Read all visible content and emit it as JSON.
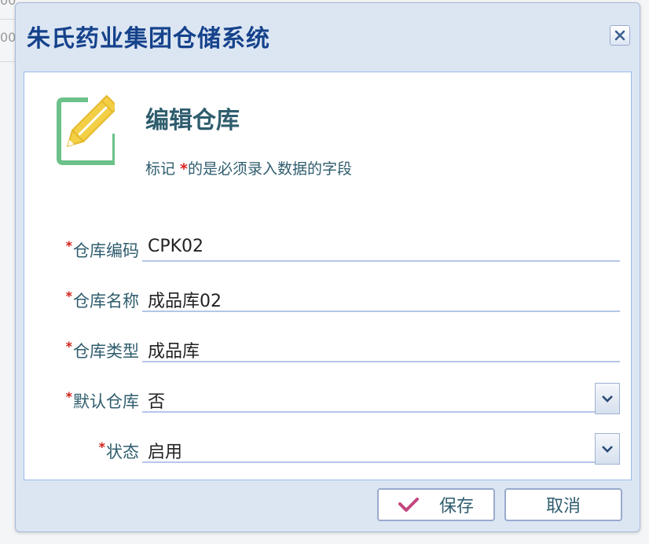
{
  "background": {
    "fragments": [
      "00",
      "00"
    ]
  },
  "dialog": {
    "title": "朱氏药业集团仓储系统",
    "close_icon": "close-icon",
    "edit_icon": "edit-pencil-icon",
    "heading": "编辑仓库",
    "hint_prefix": "标记 ",
    "hint_star": "*",
    "hint_suffix": "的是必须录入数据的字段"
  },
  "form": {
    "required_mark": "*",
    "fields": [
      {
        "label": "仓库编码",
        "value": "CPK02"
      },
      {
        "label": "仓库名称",
        "value": "成品库02"
      },
      {
        "label": "仓库类型",
        "value": "成品库"
      },
      {
        "label": "默认仓库",
        "value": "否"
      },
      {
        "label": "状态",
        "value": "启用"
      }
    ]
  },
  "footer": {
    "save_label": "保存",
    "cancel_label": "取消"
  },
  "colors": {
    "title": "#15428b",
    "text": "#2f5d6e",
    "required": "#d0201a",
    "icon_green": "#6cc28a",
    "icon_yellow": "#f3cf45",
    "check": "#c2477f"
  }
}
